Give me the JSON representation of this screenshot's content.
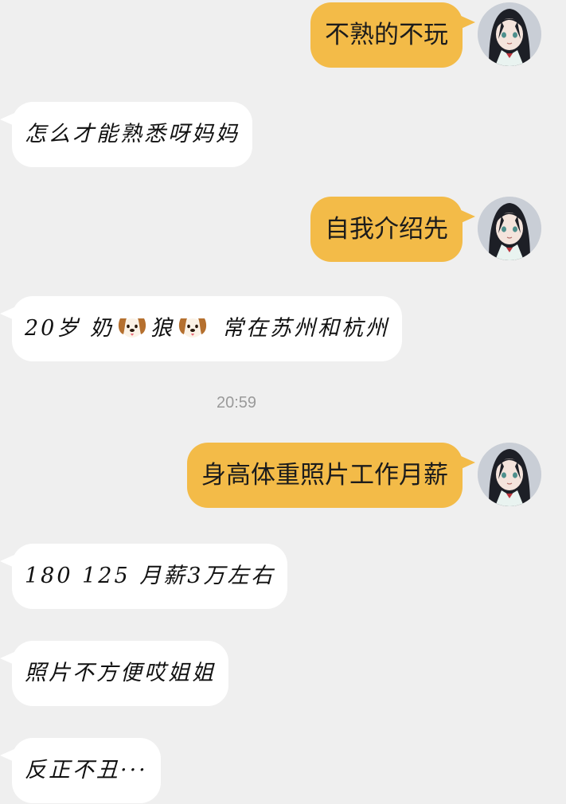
{
  "colors": {
    "background": "#efefef",
    "outgoing_bubble": "#f3bb48",
    "incoming_bubble": "#ffffff",
    "timestamp_text": "#9a9a9a"
  },
  "messages": [
    {
      "from": "me",
      "text": "不熟的不玩"
    },
    {
      "from": "them",
      "text": "怎么才能熟悉呀妈妈"
    },
    {
      "from": "me",
      "text": "自我介绍先"
    },
    {
      "from": "them",
      "parts": [
        "20岁 奶",
        "狼",
        "常在苏州和杭州"
      ],
      "emoji": "dog-face-icon"
    },
    {
      "from": "system",
      "text": "20:59"
    },
    {
      "from": "me",
      "text": "身高体重照片工作月薪"
    },
    {
      "from": "them",
      "text": "180 125 月薪3万左右"
    },
    {
      "from": "them",
      "text": "照片不方便哎姐姐"
    },
    {
      "from": "them",
      "text": "反正不丑···"
    }
  ]
}
